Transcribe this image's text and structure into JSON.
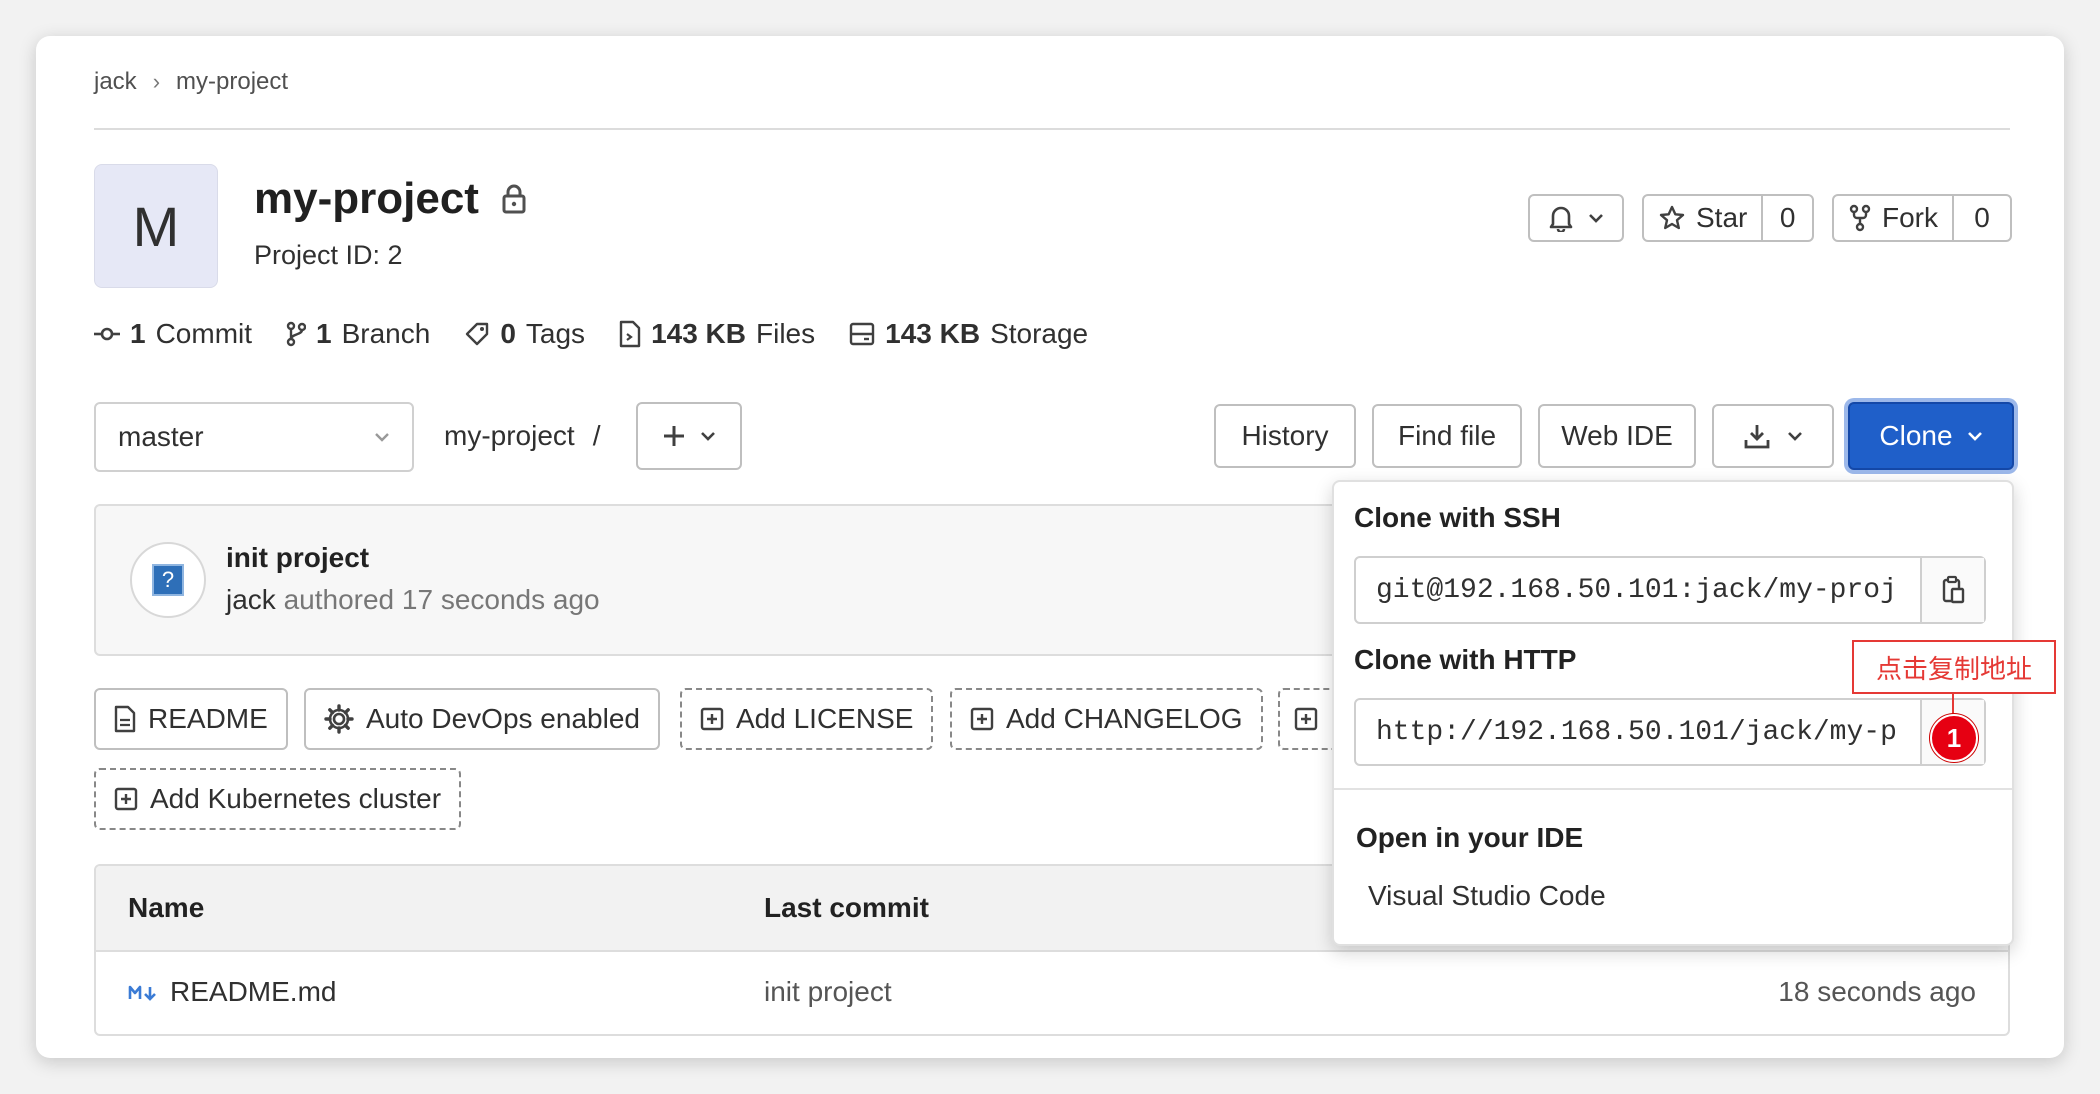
{
  "breadcrumb": {
    "owner": "jack",
    "sep": "›",
    "project": "my-project"
  },
  "project": {
    "avatar_letter": "M",
    "name": "my-project",
    "id_text": "Project ID: 2"
  },
  "actions": {
    "star_label": "Star",
    "star_count": "0",
    "fork_label": "Fork",
    "fork_count": "0"
  },
  "stats": {
    "commits_num": "1",
    "commits_label": "Commit",
    "branches_num": "1",
    "branches_label": "Branch",
    "tags_num": "0",
    "tags_label": "Tags",
    "files_num": "143 KB",
    "files_label": "Files",
    "storage_num": "143 KB",
    "storage_label": "Storage"
  },
  "toolbar": {
    "branch": "master",
    "path": "my-project",
    "path_sep": "/",
    "history": "History",
    "find_file": "Find file",
    "web_ide": "Web IDE",
    "clone": "Clone"
  },
  "last_commit": {
    "message": "init project",
    "author": "jack",
    "meta": "authored 17 seconds ago"
  },
  "quick_actions": {
    "readme": "README",
    "devops": "Auto DevOps enabled",
    "license": "Add LICENSE",
    "changelog": "Add CHANGELOG",
    "kubernetes": "Add Kubernetes cluster"
  },
  "table": {
    "col_name": "Name",
    "col_commit": "Last commit",
    "rows": [
      {
        "name": "README.md",
        "commit": "init project",
        "time": "18 seconds ago"
      }
    ]
  },
  "clone_dropdown": {
    "ssh_title": "Clone with SSH",
    "ssh_url": "git@192.168.50.101:jack/my-proj",
    "http_title": "Clone with HTTP",
    "http_url": "http://192.168.50.101/jack/my-p",
    "ide_title": "Open in your IDE",
    "ide_item": "Visual Studio Code"
  },
  "annotation": {
    "text": "点击复制地址",
    "badge": "1"
  },
  "colors": {
    "primary": "#1f5fc9",
    "annotation": "#e53935"
  }
}
